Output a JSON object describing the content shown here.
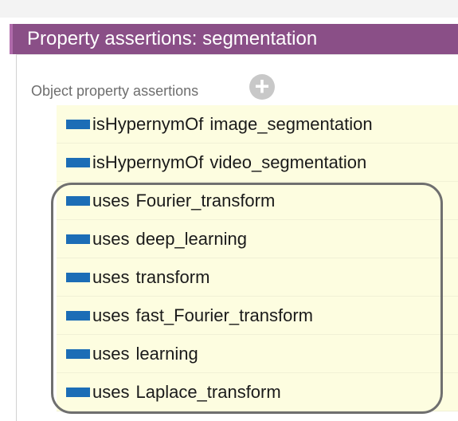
{
  "view": {
    "title": "Property assertions: segmentation"
  },
  "section": {
    "label": "Object property assertions",
    "add_icon": "plus-circle-icon"
  },
  "assertions": [
    {
      "property": "isHypernymOf",
      "value": "image_segmentation"
    },
    {
      "property": "isHypernymOf",
      "value": "video_segmentation"
    },
    {
      "property": "uses",
      "value": "Fourier_transform"
    },
    {
      "property": "uses",
      "value": "deep_learning"
    },
    {
      "property": "uses",
      "value": "transform"
    },
    {
      "property": "uses",
      "value": "fast_Fourier_transform"
    },
    {
      "property": "uses",
      "value": "learning"
    },
    {
      "property": "uses",
      "value": "Laplace_transform"
    }
  ],
  "colors": {
    "header_bg": "#8a4f87",
    "row_bg": "#fdfde0",
    "property_icon": "#1c6db6",
    "highlight_outline": "#6f6f6f"
  }
}
